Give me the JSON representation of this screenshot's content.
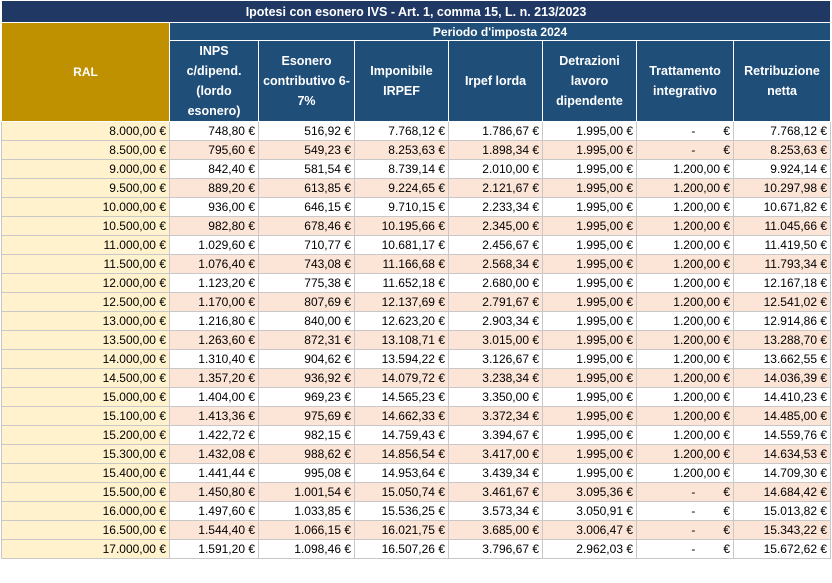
{
  "title": "Ipotesi con esonero IVS - Art. 1, comma 15, L. n. 213/2023",
  "period": "Periodo d'imposta 2024",
  "headers": {
    "ral": "RAL",
    "inps": "INPS c/dipend. (lordo esonero)",
    "esonero": "Esonero contributivo 6-7%",
    "imponibile": "Imponibile IRPEF",
    "irpef": "Irpef lorda",
    "detrazioni": "Detrazioni lavoro dipendente",
    "trattamento": "Trattamento integrativo",
    "retribuzione": "Retribuzione netta"
  },
  "rows": [
    [
      "8.000,00 €",
      "748,80 €",
      "516,92 €",
      "7.768,12 €",
      "1.786,67 €",
      "1.995,00 €",
      "-",
      "7.768,12 €"
    ],
    [
      "8.500,00 €",
      "795,60 €",
      "549,23 €",
      "8.253,63 €",
      "1.898,34 €",
      "1.995,00 €",
      "-",
      "8.253,63 €"
    ],
    [
      "9.000,00 €",
      "842,40 €",
      "581,54 €",
      "8.739,14 €",
      "2.010,00 €",
      "1.995,00 €",
      "1.200,00 €",
      "9.924,14 €"
    ],
    [
      "9.500,00 €",
      "889,20 €",
      "613,85 €",
      "9.224,65 €",
      "2.121,67 €",
      "1.995,00 €",
      "1.200,00 €",
      "10.297,98 €"
    ],
    [
      "10.000,00 €",
      "936,00 €",
      "646,15 €",
      "9.710,15 €",
      "2.233,34 €",
      "1.995,00 €",
      "1.200,00 €",
      "10.671,82 €"
    ],
    [
      "10.500,00 €",
      "982,80 €",
      "678,46 €",
      "10.195,66 €",
      "2.345,00 €",
      "1.995,00 €",
      "1.200,00 €",
      "11.045,66 €"
    ],
    [
      "11.000,00 €",
      "1.029,60 €",
      "710,77 €",
      "10.681,17 €",
      "2.456,67 €",
      "1.995,00 €",
      "1.200,00 €",
      "11.419,50 €"
    ],
    [
      "11.500,00 €",
      "1.076,40 €",
      "743,08 €",
      "11.166,68 €",
      "2.568,34 €",
      "1.995,00 €",
      "1.200,00 €",
      "11.793,34 €"
    ],
    [
      "12.000,00 €",
      "1.123,20 €",
      "775,38 €",
      "11.652,18 €",
      "2.680,00 €",
      "1.995,00 €",
      "1.200,00 €",
      "12.167,18 €"
    ],
    [
      "12.500,00 €",
      "1.170,00 €",
      "807,69 €",
      "12.137,69 €",
      "2.791,67 €",
      "1.995,00 €",
      "1.200,00 €",
      "12.541,02 €"
    ],
    [
      "13.000,00 €",
      "1.216,80 €",
      "840,00 €",
      "12.623,20 €",
      "2.903,34 €",
      "1.995,00 €",
      "1.200,00 €",
      "12.914,86 €"
    ],
    [
      "13.500,00 €",
      "1.263,60 €",
      "872,31 €",
      "13.108,71 €",
      "3.015,00 €",
      "1.995,00 €",
      "1.200,00 €",
      "13.288,70 €"
    ],
    [
      "14.000,00 €",
      "1.310,40 €",
      "904,62 €",
      "13.594,22 €",
      "3.126,67 €",
      "1.995,00 €",
      "1.200,00 €",
      "13.662,55 €"
    ],
    [
      "14.500,00 €",
      "1.357,20 €",
      "936,92 €",
      "14.079,72 €",
      "3.238,34 €",
      "1.995,00 €",
      "1.200,00 €",
      "14.036,39 €"
    ],
    [
      "15.000,00 €",
      "1.404,00 €",
      "969,23 €",
      "14.565,23 €",
      "3.350,00 €",
      "1.995,00 €",
      "1.200,00 €",
      "14.410,23 €"
    ],
    [
      "15.100,00 €",
      "1.413,36 €",
      "975,69 €",
      "14.662,33 €",
      "3.372,34 €",
      "1.995,00 €",
      "1.200,00 €",
      "14.485,00 €"
    ],
    [
      "15.200,00 €",
      "1.422,72 €",
      "982,15 €",
      "14.759,43 €",
      "3.394,67 €",
      "1.995,00 €",
      "1.200,00 €",
      "14.559,76 €"
    ],
    [
      "15.300,00 €",
      "1.432,08 €",
      "988,62 €",
      "14.856,54 €",
      "3.417,00 €",
      "1.995,00 €",
      "1.200,00 €",
      "14.634,53 €"
    ],
    [
      "15.400,00 €",
      "1.441,44 €",
      "995,08 €",
      "14.953,64 €",
      "3.439,34 €",
      "1.995,00 €",
      "1.200,00 €",
      "14.709,30 €"
    ],
    [
      "15.500,00 €",
      "1.450,80 €",
      "1.001,54 €",
      "15.050,74 €",
      "3.461,67 €",
      "3.095,36 €",
      "-",
      "14.684,42 €"
    ],
    [
      "16.000,00 €",
      "1.497,60 €",
      "1.033,85 €",
      "15.536,25 €",
      "3.573,34 €",
      "3.050,91 €",
      "-",
      "15.013,82 €"
    ],
    [
      "16.500,00 €",
      "1.544,40 €",
      "1.066,15 €",
      "16.021,75 €",
      "3.685,00 €",
      "3.006,47 €",
      "-",
      "15.343,22 €"
    ],
    [
      "17.000,00 €",
      "1.591,20 €",
      "1.098,46 €",
      "16.507,26 €",
      "3.796,67 €",
      "2.962,03 €",
      "-",
      "15.672,62 €"
    ]
  ]
}
